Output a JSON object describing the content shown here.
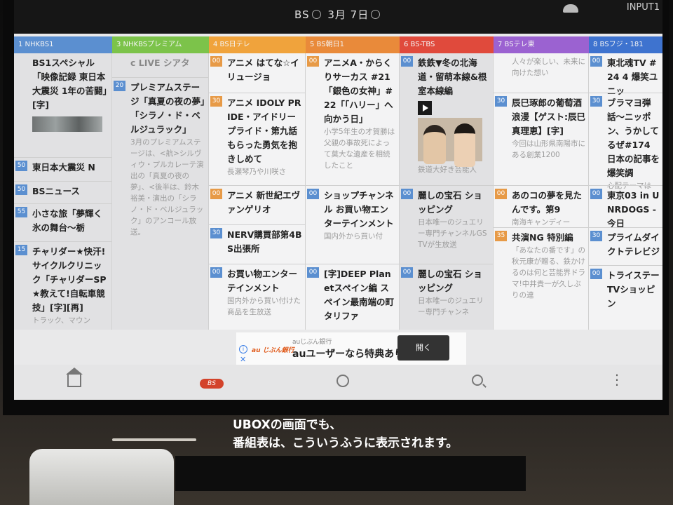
{
  "topbar": {
    "band": "BS",
    "month": "3月",
    "day": "7日",
    "input_label": "INPUT1"
  },
  "channels": [
    {
      "label": "1 NHKBS1",
      "color": "#5b8fd0"
    },
    {
      "label": "3 NHKBSプレミアム",
      "color": "#7cc34a"
    },
    {
      "label": "4 BS日テレ",
      "color": "#f0a33c"
    },
    {
      "label": "5 BS朝日1",
      "color": "#e98a3a"
    },
    {
      "label": "6 BS-TBS",
      "color": "#e04a3c"
    },
    {
      "label": "7 BSテレ東",
      "color": "#9b62d1"
    },
    {
      "label": "8 BSフジ・181",
      "color": "#3e73cf"
    }
  ],
  "col1": [
    {
      "title": "BS1スペシャル「映像記録 東日本大震災 1年の苦闘」[字]"
    },
    {
      "min": "50",
      "title": "東日本大震災 N"
    },
    {
      "min": "50",
      "title": "BSニュース"
    },
    {
      "min": "55",
      "title": "小さな旅「夢輝く氷の舞台〜栃"
    },
    {
      "min": "15",
      "title": "チャリダー★快汗!サイクルクリニック「チャリダーSP★教えて!自転車競技」[字][再]",
      "desc": "トラック、マウン"
    }
  ],
  "col2": [
    {
      "title": "c LIVE シアタ"
    },
    {
      "min": "20",
      "title": "プレミアムステージ「真夏の夜の夢」「シラノ・ド・ベルジュラック」",
      "desc": "3月のプレミアムステージは、<航>シルヴィウ・プルカレーテ演出の「真夏の夜の夢」、<後半は、鈴木裕美・演出の「シラノ・ド・ベルジュラック」のアンコール放送。"
    }
  ],
  "col3": [
    {
      "min": "00",
      "title": "アニメ はてな☆イリュージョ"
    },
    {
      "min": "30",
      "title": "アニメ IDOLY PRIDE・アイドリープライド・第九話 もらった勇気を抱きしめて",
      "desc": "長瀬琴乃や川咲さ"
    },
    {
      "min": "00",
      "title": "アニメ 新世紀エヴァンゲリオ"
    },
    {
      "min": "30",
      "title": "NERV購買部第4BS出張所"
    },
    {
      "min": "00",
      "title": "お買い物エンターテインメント",
      "desc": "国内外から買い付けた商品を生放送"
    }
  ],
  "col4": [
    {
      "min": "00",
      "title": "アニメA・からくりサーカス #21「銀色の女神」#22「「ハリー」へ向かう日」",
      "desc": "小学5年生の才賀勝は父親の事故死によって莫大な遺産を相続したこと"
    },
    {
      "min": "00",
      "title": "ショップチャンネル お買い物エンターテインメント",
      "desc": "国内外から買い付"
    },
    {
      "min": "00",
      "title": "[字]DEEP Planetスペイン編 スペイン最南端の町 タリファ"
    }
  ],
  "col5": [
    {
      "min": "00",
      "title": "鉄鉄▼冬の北海道・留萌本線&根室本線編",
      "desc": "鉄道大好き芸能人"
    },
    {
      "min": "00",
      "title": "麗しの宝石 ショッピング",
      "desc": "日本唯一のジュエリー専門チャンネルGSTVが生放送"
    },
    {
      "min": "00",
      "title": "麗しの宝石 ショッピング",
      "desc": "日本唯一のジュエリー専門チャンネ"
    }
  ],
  "col6": [
    {
      "desc": "人々が楽しい、未来に向けた想い"
    },
    {
      "min": "30",
      "title": "辰巳琢郎の葡萄酒浪漫【ゲスト:辰巳真理恵】[字]",
      "desc": "今回は山形県南陽市にある創業1200"
    },
    {
      "min": "00",
      "title": "あのコの夢を見たんです。第9",
      "desc": "南海キャンディー"
    },
    {
      "min": "35",
      "title": "共演NG 特別編",
      "desc": "「あなたの番です」の秋元康が贈る、鉄かけるのは何と芸能界ドラマ!中井貴一が久しぶりの連"
    }
  ],
  "col7": [
    {
      "min": "00",
      "title": "東北魂TV #24 4 爆笑ユニッ"
    },
    {
      "min": "30",
      "title": "ブラマヨ弾話〜ニッポン、うかしてるぜ#174 日本の記事を爆笑調",
      "desc": "心配テーマは"
    },
    {
      "min": "00",
      "title": "東京03 in UNRDOGS -今日"
    },
    {
      "min": "30",
      "title": "プライムダイクトテレビジ"
    },
    {
      "min": "00",
      "title": "トライステーTVショッピン"
    }
  ],
  "ad": {
    "logo": "au じぶん銀行",
    "sponsor": "auじぶん銀行",
    "message": "auユーザーなら特典あり",
    "button": "開く"
  },
  "nav": {
    "bs_label": "BS"
  },
  "caption": {
    "line1": "UBOXの画面でも、",
    "line2": "番組表は、こういうふうに表示されます。"
  }
}
